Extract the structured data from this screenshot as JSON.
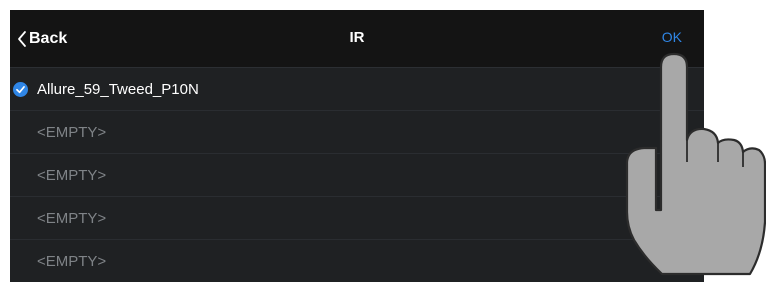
{
  "header": {
    "back_label": "Back",
    "title": "IR",
    "ok_label": "OK"
  },
  "list": {
    "items": [
      {
        "label": "Allure_59_Tweed_P10N",
        "selected": true
      },
      {
        "label": "<EMPTY>",
        "selected": false
      },
      {
        "label": "<EMPTY>",
        "selected": false
      },
      {
        "label": "<EMPTY>",
        "selected": false
      },
      {
        "label": "<EMPTY>",
        "selected": false
      }
    ]
  },
  "icons": {
    "back": "chevron-left-icon",
    "selected": "checkmark-circle-icon",
    "pointer": "pointing-hand-icon"
  },
  "colors": {
    "accent": "#2f86e6",
    "background": "#1f2123",
    "navbar": "#141414",
    "muted_text": "#7f8387"
  }
}
